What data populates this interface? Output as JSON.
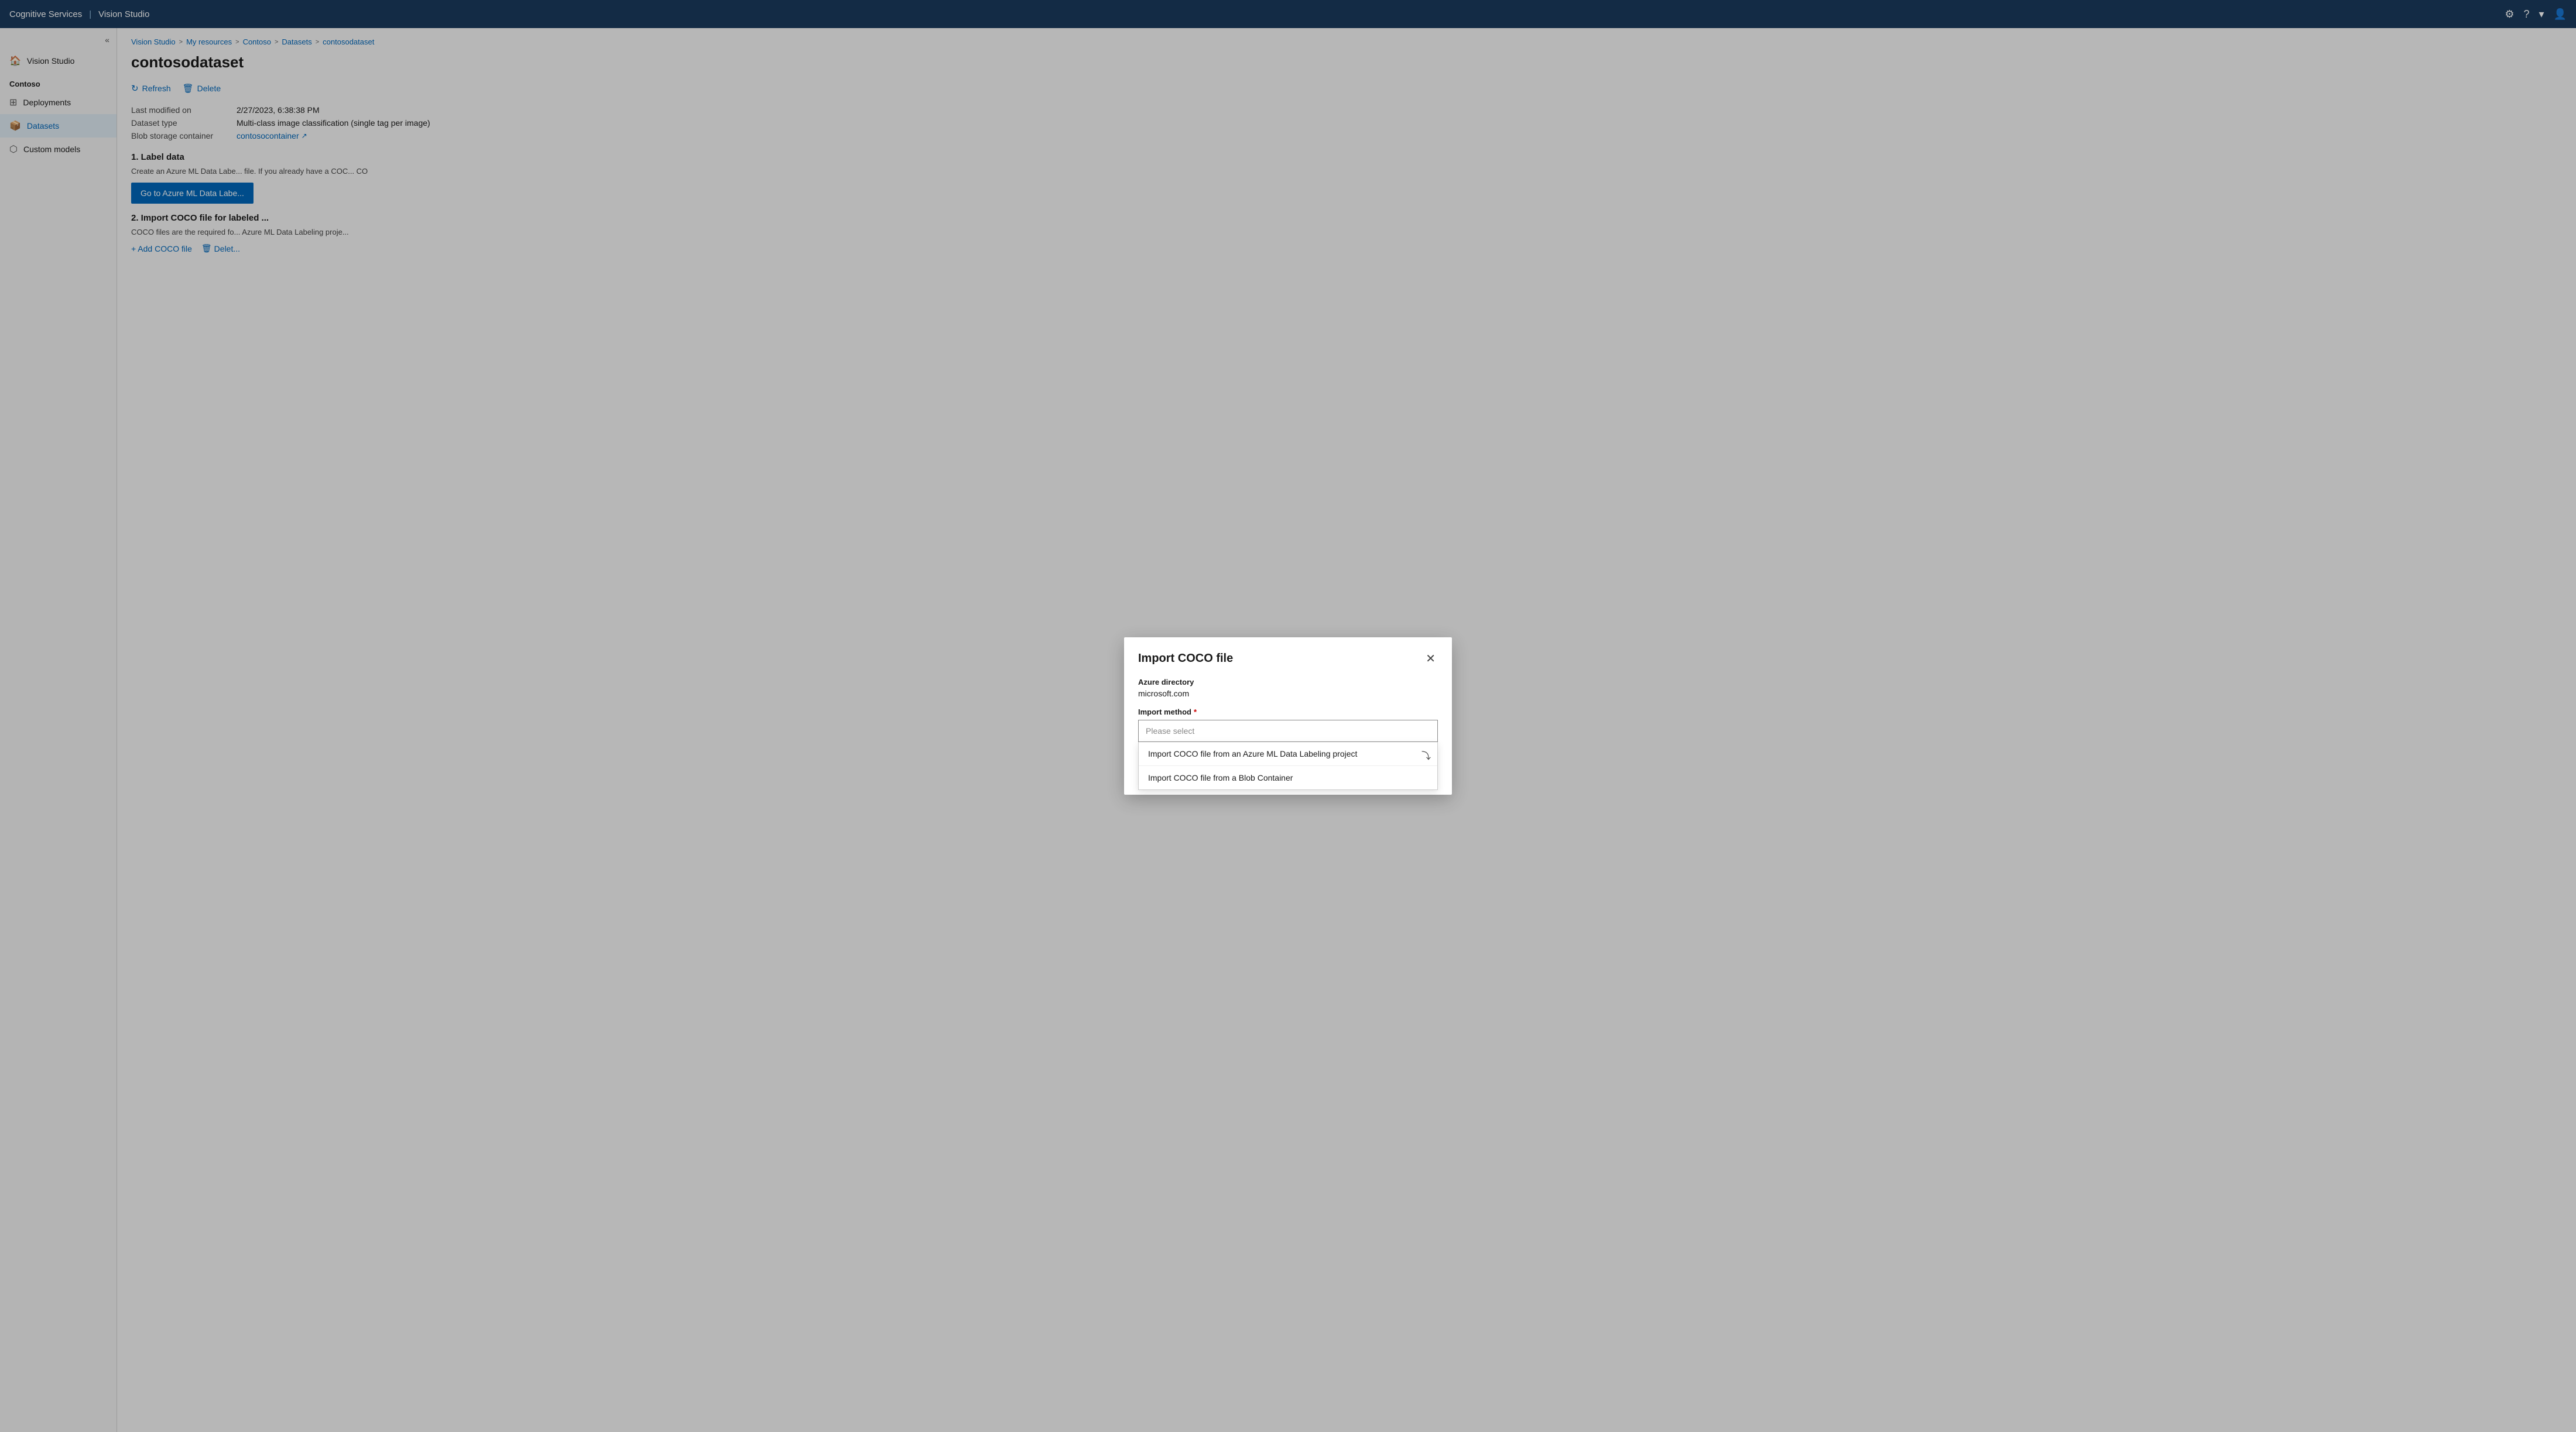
{
  "app": {
    "name": "Cognitive Services",
    "separator": "|",
    "product": "Vision Studio"
  },
  "topbar": {
    "settings_icon": "⚙",
    "help_icon": "?",
    "dropdown_icon": "▾",
    "user_icon": "👤"
  },
  "sidebar": {
    "collapse_icon": "«",
    "home_icon": "🏠",
    "home_label": "Vision Studio",
    "section_label": "Contoso",
    "deployments_icon": "⊞",
    "deployments_label": "Deployments",
    "datasets_icon": "📦",
    "datasets_label": "Datasets",
    "custom_models_icon": "⬡",
    "custom_models_label": "Custom models"
  },
  "breadcrumb": {
    "items": [
      "Vision Studio",
      "My resources",
      "Contoso",
      "Datasets",
      "contosodataset"
    ],
    "separators": [
      ">",
      ">",
      ">",
      ">"
    ]
  },
  "page": {
    "title": "contosodataset",
    "refresh_label": "Refresh",
    "delete_label": "Delete"
  },
  "metadata": {
    "last_modified_label": "Last modified on",
    "last_modified_value": "2/27/2023, 6:38:38 PM",
    "dataset_type_label": "Dataset type",
    "dataset_type_value": "Multi-class image classification (single tag per image)",
    "blob_storage_label": "Blob storage container",
    "blob_storage_link": "contosocontainer",
    "blob_storage_icon": "↗"
  },
  "section1": {
    "title": "1. Label data",
    "description": "Create an Azure ML Data Labe... file. If you already have a COC...",
    "button_label": "Go to Azure ML Data Labe...",
    "coco_suffix": "CO"
  },
  "section2": {
    "title": "2. Import COCO file for labeled ...",
    "description": "COCO files are the required fo... Azure ML Data Labeling proje...",
    "add_label": "+ Add COCO file",
    "delete_label": "Delet..."
  },
  "modal": {
    "title": "Import COCO file",
    "close_icon": "✕",
    "azure_directory_label": "Azure directory",
    "azure_directory_value": "microsoft.com",
    "import_method_label": "Import method",
    "required_marker": "*",
    "select_placeholder": "Please select",
    "chevron_icon": "⌄",
    "options": [
      "Import COCO file from an Azure ML Data Labeling project",
      "Import COCO file from a Blob Container"
    ]
  }
}
